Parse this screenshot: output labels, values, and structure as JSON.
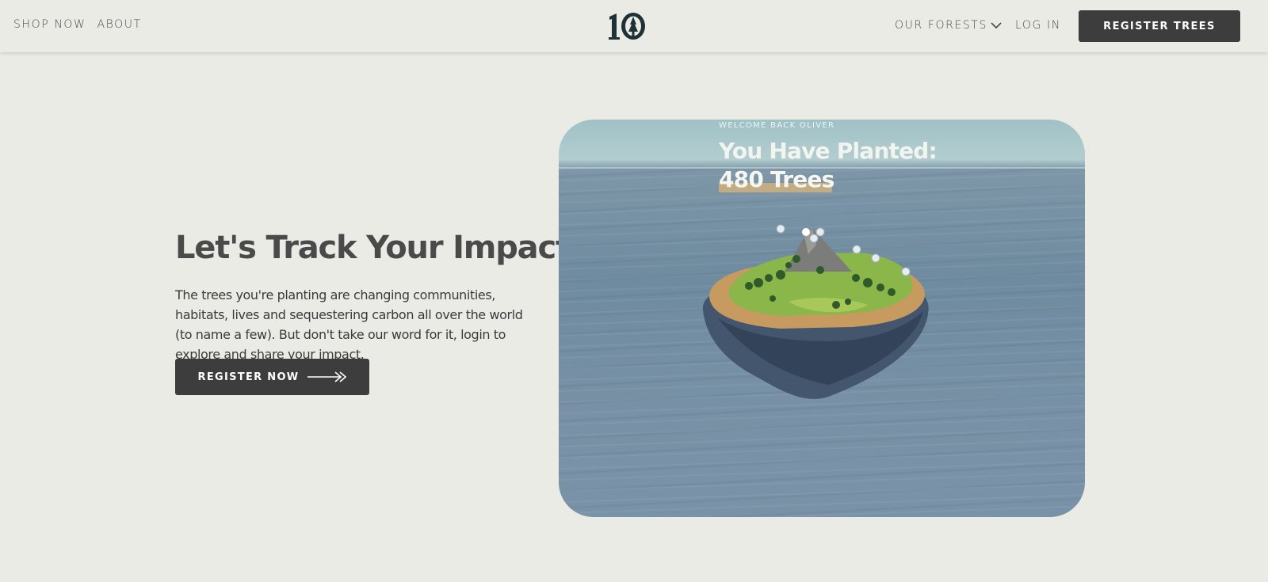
{
  "header": {
    "nav_left": [
      {
        "label": "SHOP NOW"
      },
      {
        "label": "ABOUT"
      }
    ],
    "logo_text": "10",
    "our_forests_label": "OUR FORESTS",
    "login_label": "LOG IN",
    "register_trees_label": "REGISTER TREES"
  },
  "hero": {
    "title": "Let's Track Your Impact",
    "body": "The trees you're planting are changing communities, habitats, lives and sequestering carbon all over the world (to name a few). But don't take our word for it, login to explore and share your impact.",
    "cta_label": "REGISTER NOW"
  },
  "visual": {
    "welcome": "WELCOME BACK OLIVER",
    "planted_label": "You Have Planted:",
    "trees_count": "480 Trees"
  },
  "colors": {
    "background": "#ebebe6",
    "button": "#3d3d3d",
    "logo": "#1f3036"
  }
}
